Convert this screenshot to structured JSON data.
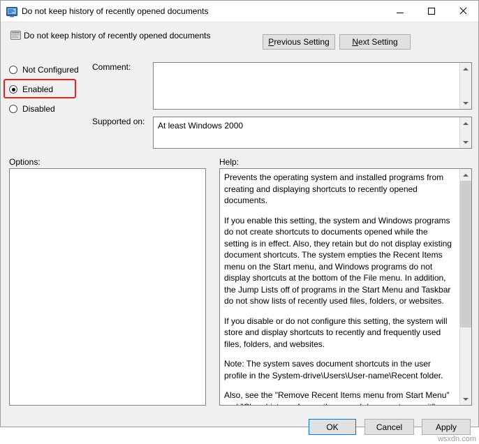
{
  "window": {
    "title": "Do not keep history of recently opened documents",
    "icon": "policy-editor-icon",
    "minimize_label": "Minimize",
    "maximize_label": "Maximize",
    "close_label": "Close"
  },
  "header": {
    "setting_name": "Do not keep history of recently opened documents",
    "previous_button": "Previous Setting",
    "previous_accesskey": "P",
    "next_button": "Next Setting",
    "next_accesskey": "N"
  },
  "state_options": [
    {
      "label": "Not Configured",
      "checked": false
    },
    {
      "label": "Enabled",
      "checked": true
    },
    {
      "label": "Disabled",
      "checked": false
    }
  ],
  "highlight_color": "#e8211c",
  "fields": {
    "comment_label": "Comment:",
    "comment_value": "",
    "supported_label": "Supported on:",
    "supported_value": "At least Windows 2000"
  },
  "panels": {
    "options_label": "Options:",
    "options_content": "",
    "help_label": "Help:",
    "help_paragraphs": [
      "Prevents the operating system and installed programs from creating and displaying shortcuts to recently opened documents.",
      "If you enable this setting, the system and Windows programs do not create shortcuts to documents opened while the setting is in effect. Also, they retain but do not display existing document shortcuts. The system empties the Recent Items menu on the Start menu, and Windows programs do not display shortcuts at the bottom of the File menu. In addition, the Jump Lists off of programs in the Start Menu and Taskbar do not show lists of recently used files, folders, or websites.",
      "If you disable or do not configure this setting, the system will store and display shortcuts to recently and frequently used files, folders, and websites.",
      "Note: The system saves document shortcuts in the user profile in the System-drive\\Users\\User-name\\Recent folder.",
      "Also, see the \"Remove Recent Items menu from Start Menu\" and \"Clear history of recently opened documents on exit\" policies in"
    ]
  },
  "footer": {
    "ok_label": "OK",
    "cancel_label": "Cancel",
    "apply_label": "Apply"
  },
  "watermark": "wsxdn.com"
}
